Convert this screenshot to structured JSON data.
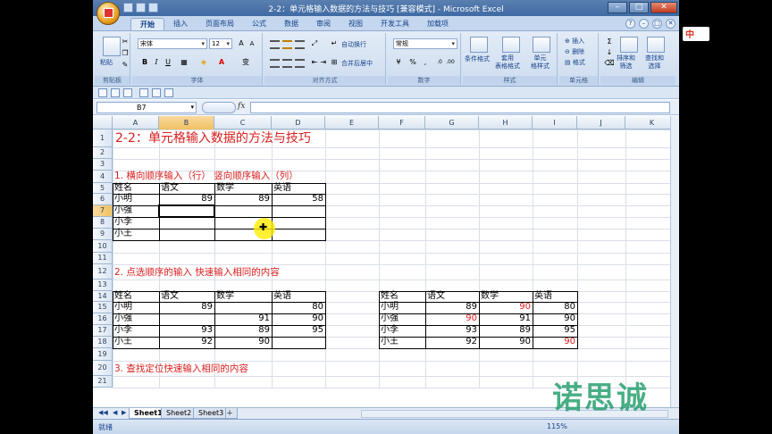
{
  "window": {
    "title": "2-2：单元格输入数据的方法与技巧  [兼容模式] - Microsoft Excel"
  },
  "tabs": [
    "开始",
    "插入",
    "页面布局",
    "公式",
    "数据",
    "审阅",
    "视图",
    "开发工具",
    "加载项"
  ],
  "ribbon": {
    "clipboard": {
      "paste": "粘贴",
      "label": "剪贴板"
    },
    "font": {
      "name": "宋体",
      "size": "12",
      "bold": "B",
      "italic": "I",
      "underline": "U",
      "wen": "变",
      "label": "字体"
    },
    "alignment": {
      "wrap": "自动换行",
      "merge": "合并后居中",
      "label": "对齐方式"
    },
    "number": {
      "format": "常规",
      "label": "数字"
    },
    "styles": {
      "cond": "条件格式",
      "table": "套用\n表格格式",
      "cell": "单元\n格样式",
      "label": "样式"
    },
    "cells": {
      "insert": "插入",
      "delete": "删除",
      "format": "格式",
      "label": "单元格"
    },
    "editing": {
      "sort": "排序和\n筛选",
      "find": "查找和\n选择",
      "label": "编辑"
    }
  },
  "formula_bar": {
    "name_box": "B7",
    "fx": "fx",
    "content": ""
  },
  "columns": [
    "A",
    "B",
    "C",
    "D",
    "E",
    "F",
    "G",
    "H",
    "I",
    "J",
    "K"
  ],
  "rows": [
    "1",
    "2",
    "3",
    "4",
    "5",
    "6",
    "7",
    "8",
    "9",
    "10",
    "11",
    "12",
    "13",
    "14",
    "15",
    "16",
    "17",
    "18",
    "19",
    "20",
    "21"
  ],
  "sheet": {
    "title": "2-2：单元格输入数据的方法与技巧",
    "section1": "1. 横向顺序输入（行）   竖向顺序输入（列）",
    "section2": "2. 点选顺序的输入    快速输入相同的内容",
    "section3": "3. 查找定位快速输入相同的内容",
    "table1": {
      "header": [
        "姓名",
        "语文",
        "数学",
        "英语"
      ],
      "rows": [
        [
          "小明",
          "89",
          "89",
          "58"
        ],
        [
          "小强",
          "",
          "",
          ""
        ],
        [
          "小李",
          "",
          "",
          ""
        ],
        [
          "小王",
          "",
          "",
          ""
        ]
      ]
    },
    "table2": {
      "header": [
        "姓名",
        "语文",
        "数学",
        "英语"
      ],
      "rows": [
        [
          "小明",
          "89",
          "",
          "80"
        ],
        [
          "小强",
          "",
          "91",
          "90"
        ],
        [
          "小李",
          "93",
          "89",
          "95"
        ],
        [
          "小王",
          "92",
          "90",
          ""
        ]
      ]
    },
    "table3": {
      "header": [
        "姓名",
        "语文",
        "数学",
        "英语"
      ],
      "rows": [
        [
          "小明",
          "89",
          "90",
          "80"
        ],
        [
          "小强",
          "90",
          "91",
          "90"
        ],
        [
          "小李",
          "93",
          "89",
          "95"
        ],
        [
          "小王",
          "92",
          "90",
          "90"
        ]
      ]
    }
  },
  "sheet_tabs": [
    "Sheet1",
    "Sheet2",
    "Sheet3"
  ],
  "status": {
    "text": "就绪",
    "zoom": "115%"
  },
  "overlay": {
    "logo": "中",
    "watermark": "诺思诚"
  }
}
